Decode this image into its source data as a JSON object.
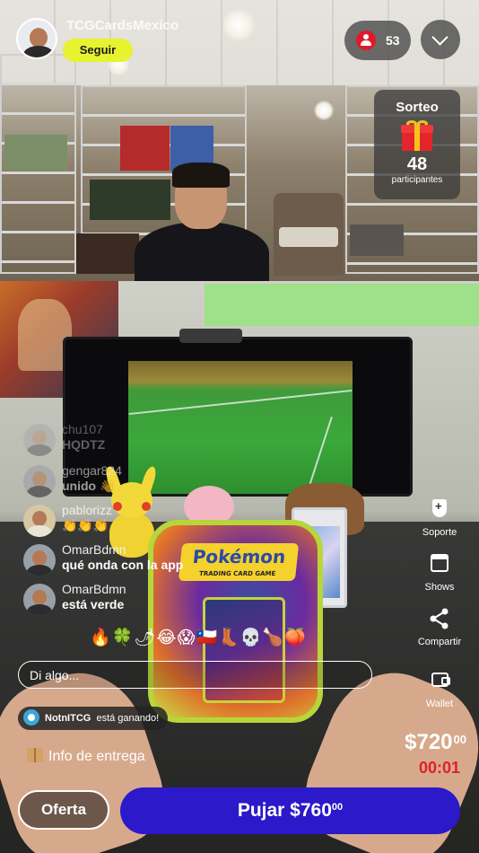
{
  "streamer": {
    "username": "TCGCardsMexico",
    "follow_label": "Seguir"
  },
  "viewers": {
    "count": "53"
  },
  "giveaway": {
    "title": "Sorteo",
    "count": "48",
    "label": "participantes"
  },
  "chat": [
    {
      "user": "chu107",
      "text": "HQDTZ"
    },
    {
      "user": "gengar824",
      "text": "unido 👋"
    },
    {
      "user": "pablorizz",
      "text": "👏👏👏"
    },
    {
      "user": "OmarBdmn",
      "text": "qué onda con la app"
    },
    {
      "user": "OmarBdmn",
      "text": "está verde"
    }
  ],
  "reactions": "🔥🍀🌶😂😱🇨🇱👢💀🍗🍑",
  "comment": {
    "placeholder": "Di algo..."
  },
  "winner": {
    "user": "NotnITCG",
    "text": "está ganando!"
  },
  "delivery": {
    "label": "Info de entrega"
  },
  "side_actions": {
    "support": "Soporte",
    "shows": "Shows",
    "share": "Compartir",
    "wallet": "Wallet"
  },
  "auction": {
    "price_main": "$720",
    "price_cents": "00",
    "timer": "00:01"
  },
  "buttons": {
    "offer": "Oferta",
    "bid_main": "Pujar $760",
    "bid_cents": "00"
  },
  "product": {
    "tin_logo": "Pokémon",
    "tin_subtitle": "TRADING CARD GAME"
  },
  "colors": {
    "follow_button": "#e7f230",
    "bid_button": "#2c19c9",
    "timer": "#e0202a",
    "viewer_icon": "#e0182a"
  }
}
